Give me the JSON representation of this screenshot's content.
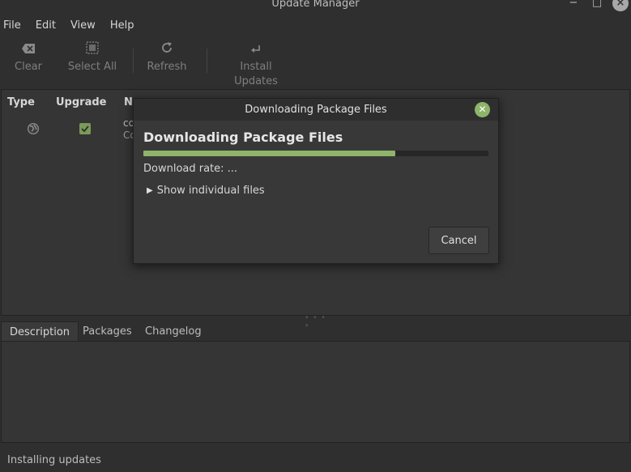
{
  "window": {
    "title": "Update Manager",
    "min": "−",
    "max": "□",
    "close": "×"
  },
  "menu": [
    "File",
    "Edit",
    "View",
    "Help"
  ],
  "toolbar": {
    "clear": "Clear",
    "select_all": "Select All",
    "refresh": "Refresh",
    "install": "Install Updates"
  },
  "list": {
    "columns": {
      "type": "Type",
      "upgrade": "Upgrade",
      "name_partial": "Na"
    },
    "row": {
      "name_partial": "co",
      "desc_partial": "Co"
    }
  },
  "tabs": [
    "Description",
    "Packages",
    "Changelog"
  ],
  "status": "Installing updates",
  "dialog": {
    "title": "Downloading Package Files",
    "heading": "Downloading Package Files",
    "progress": 0.73,
    "rate": "Download rate: ...",
    "expander": "Show individual files",
    "cancel": "Cancel",
    "accent": "#8fb36a"
  }
}
